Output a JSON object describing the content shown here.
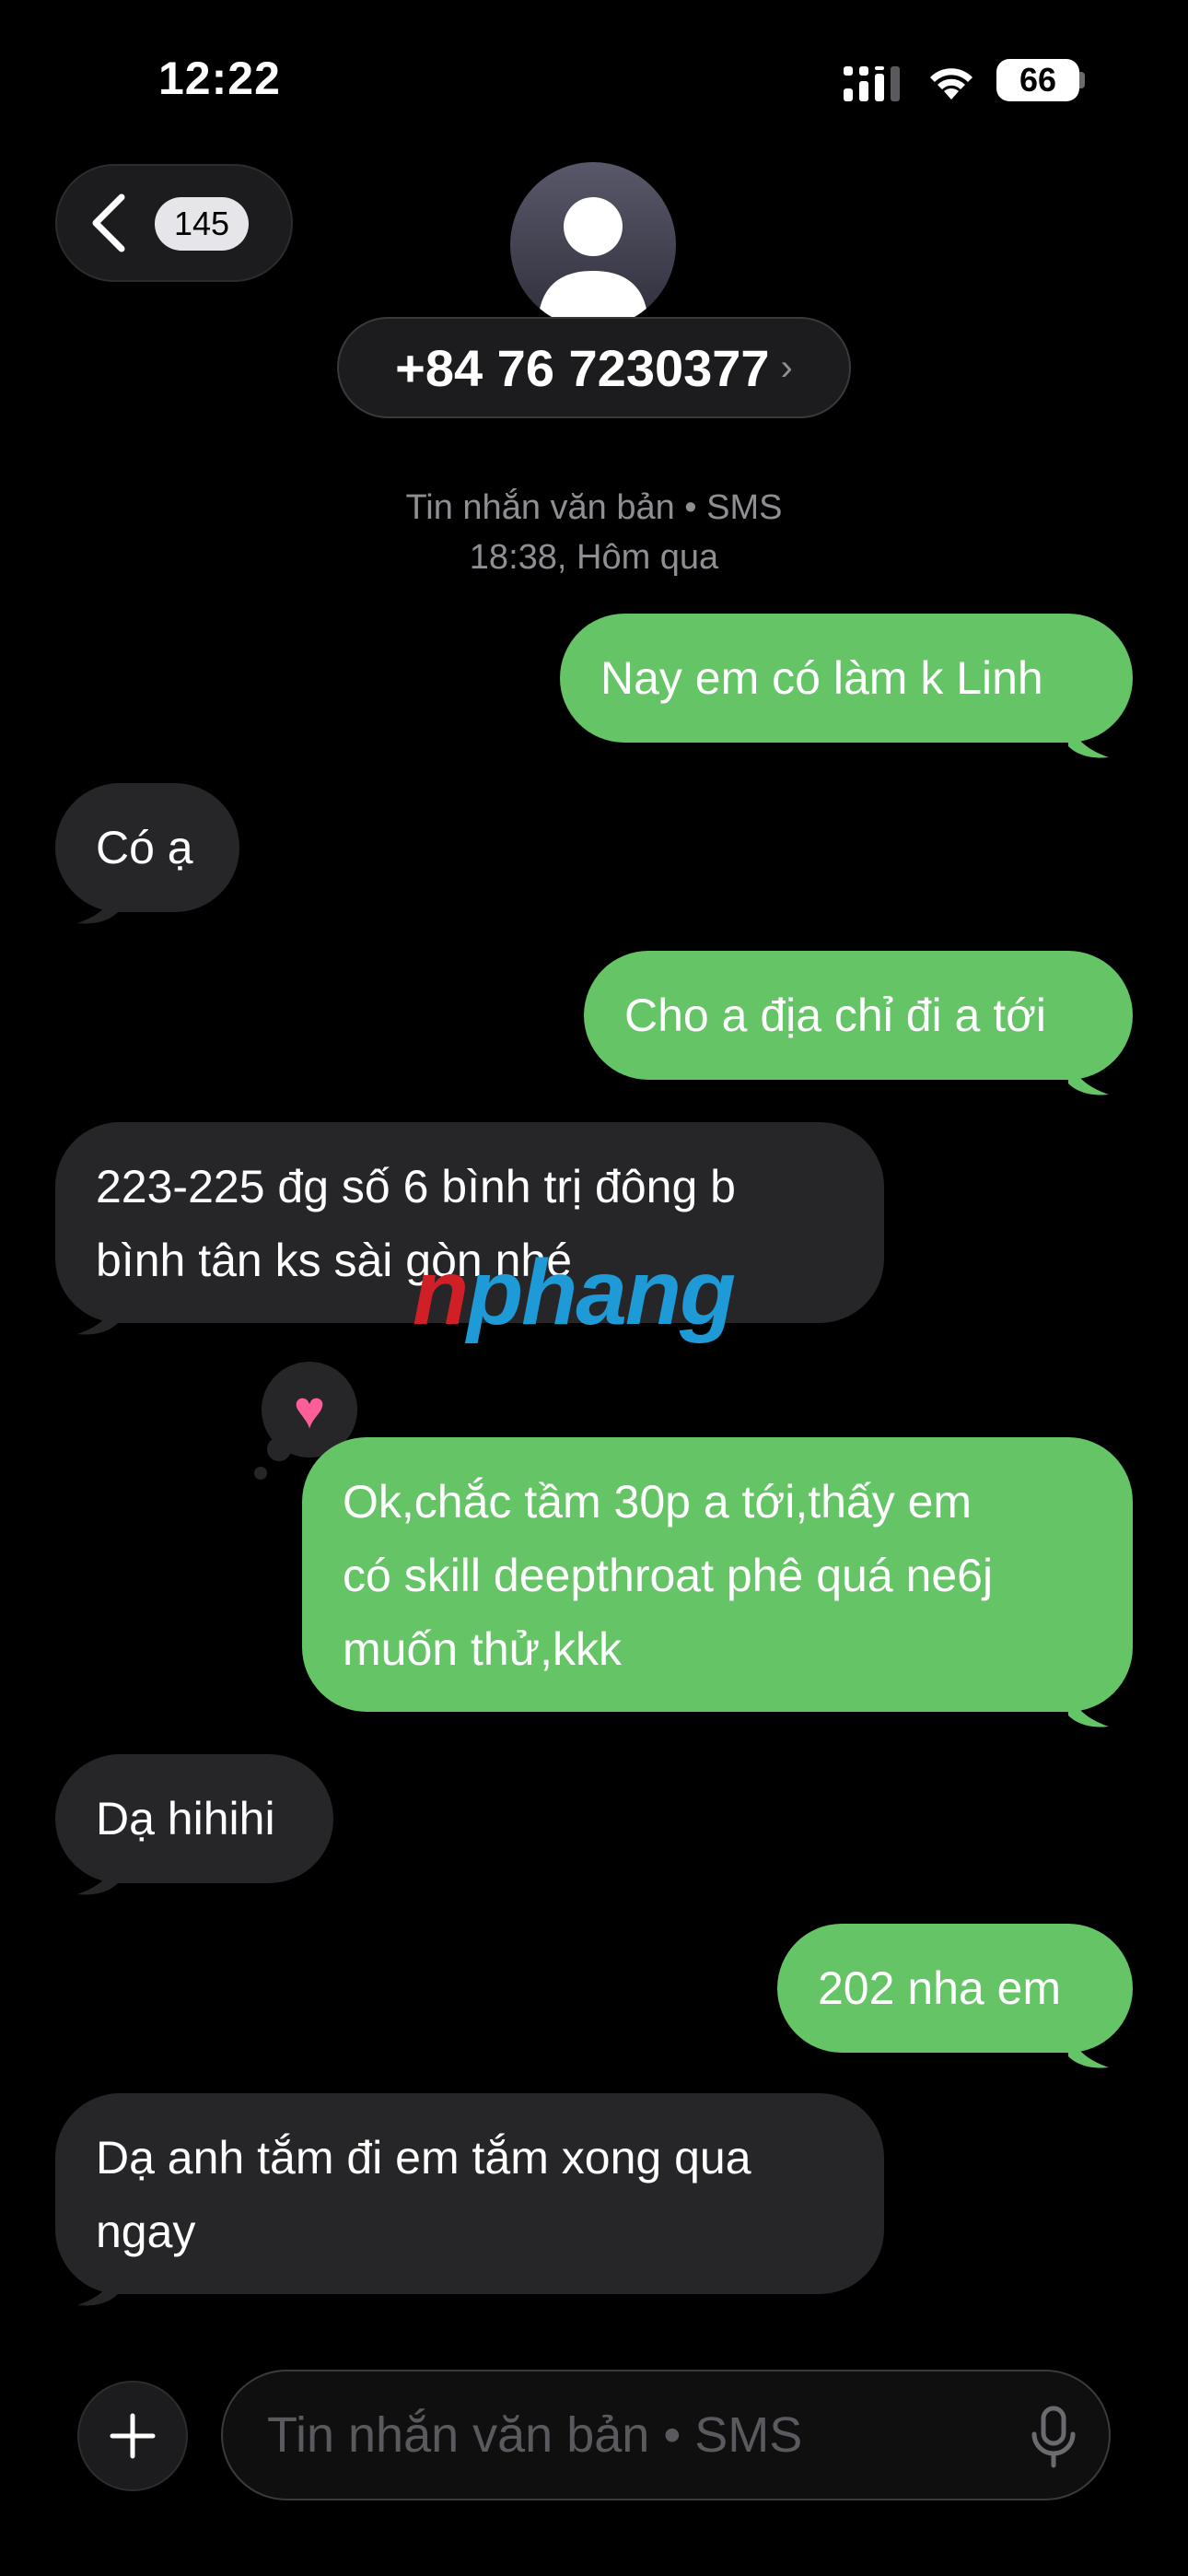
{
  "status_bar": {
    "time": "12:22",
    "battery": "66"
  },
  "header": {
    "back_count": "145",
    "contact": "+84 76 7230377",
    "contact_chevron": "›"
  },
  "thread": {
    "service": "Tin nhắn văn bản • SMS",
    "timestamp": "18:38, Hôm qua"
  },
  "messages": [
    {
      "dir": "out",
      "lines": [
        "Nay em có làm k Linh"
      ]
    },
    {
      "dir": "in",
      "lines": [
        "Có ạ"
      ]
    },
    {
      "dir": "out",
      "lines": [
        "Cho a địa chỉ đi a tới"
      ]
    },
    {
      "dir": "in",
      "lines": [
        "223-225 đg số 6 bình trị đông b",
        "bình tân ks sài gòn nhé"
      ]
    },
    {
      "dir": "out",
      "lines": [
        "Ok,chắc tầm 30p a tới,thấy em",
        "có skill deepthroat phê quá ne6j",
        "muốn thử,kkk"
      ]
    },
    {
      "dir": "in",
      "lines": [
        "Dạ hihihi"
      ]
    },
    {
      "dir": "out",
      "lines": [
        "202 nha em"
      ]
    },
    {
      "dir": "in",
      "lines": [
        "Dạ anh tắm đi em tắm xong qua",
        "ngay"
      ]
    }
  ],
  "reaction": {
    "icon": "heart-icon",
    "glyph": "♥"
  },
  "watermark": {
    "part1": "n",
    "part2": "phang"
  },
  "input": {
    "placeholder": "Tin nhắn văn bản • SMS"
  },
  "colors": {
    "outgoing": "#65c466",
    "incoming": "#262628",
    "background": "#000000"
  }
}
